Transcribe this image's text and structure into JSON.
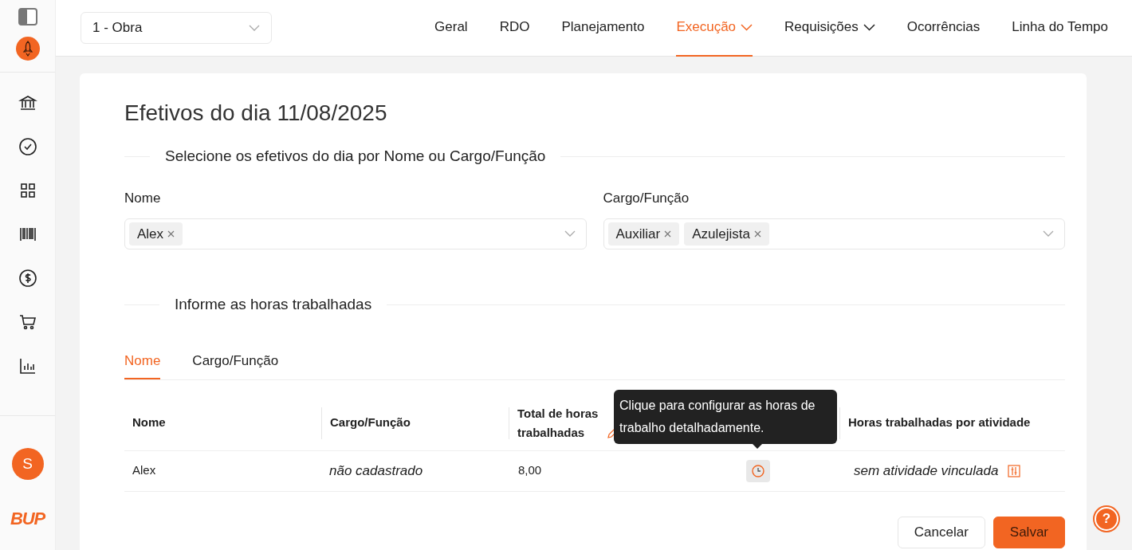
{
  "project_select": {
    "value": "1 - Obra"
  },
  "nav": [
    {
      "label": "Geral",
      "selected": false,
      "dropdown": false
    },
    {
      "label": "RDO",
      "selected": false,
      "dropdown": false
    },
    {
      "label": "Planejamento",
      "selected": false,
      "dropdown": false
    },
    {
      "label": "Execução",
      "selected": true,
      "dropdown": true
    },
    {
      "label": "Requisições",
      "selected": false,
      "dropdown": true
    },
    {
      "label": "Ocorrências",
      "selected": false,
      "dropdown": false
    },
    {
      "label": "Linha do Tempo",
      "selected": false,
      "dropdown": false
    }
  ],
  "sidebar": {
    "avatar": "S",
    "logo": "BUP"
  },
  "title": "Efetivos do dia 11/08/2025",
  "select_section": "Selecione os efetivos do dia por Nome ou Cargo/Função",
  "filters": [
    {
      "label": "Nome",
      "tags": [
        "Alex"
      ]
    },
    {
      "label": "Cargo/Função",
      "tags": [
        "Auxiliar",
        "Azulejista"
      ]
    }
  ],
  "hours_section": "Informe as horas trabalhadas",
  "tabs": [
    {
      "label": "Nome",
      "selected": true
    },
    {
      "label": "Cargo/Função",
      "selected": false
    }
  ],
  "table": {
    "columns": [
      {
        "kind": "text",
        "label": "Nome"
      },
      {
        "kind": "text",
        "label": "Cargo/Função"
      },
      {
        "kind": "editable",
        "label": "Total de horas trabalhadas"
      },
      {
        "kind": "hidden"
      },
      {
        "kind": "text",
        "label": "Horas trabalhadas por atividade"
      }
    ],
    "rows": [
      {
        "name": "Alex",
        "role": "não cadastrado",
        "total": "8,00",
        "activity": "sem atividade vinculada"
      }
    ]
  },
  "tooltip": "Clique para configurar as horas de trabalho detalhadamente.",
  "buttons": [
    {
      "kind": "secondary",
      "label": "Cancelar"
    },
    {
      "kind": "primary",
      "label": "Salvar"
    }
  ],
  "help": "?"
}
